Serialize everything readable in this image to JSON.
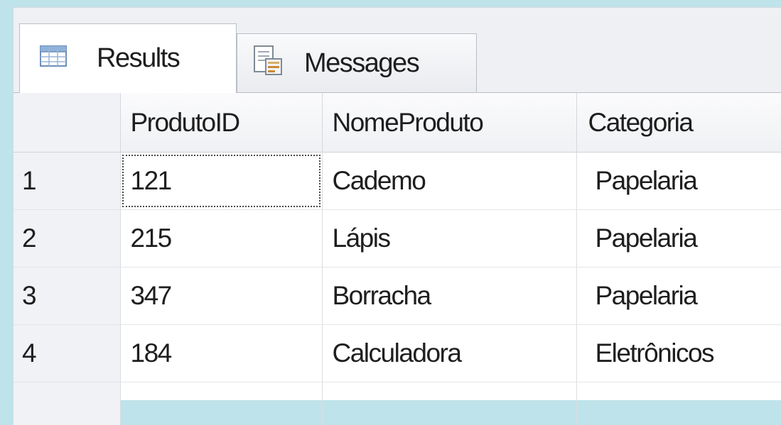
{
  "tabs": {
    "results": {
      "label": "Results",
      "icon": "grid-table-icon"
    },
    "messages": {
      "label": "Messages",
      "icon": "messages-document-icon"
    }
  },
  "grid": {
    "columns": [
      "ProdutoID",
      "NomeProduto",
      "Categoria"
    ],
    "rows": [
      {
        "num": "1",
        "cells": [
          "121",
          "Cademo",
          "Papelaria"
        ]
      },
      {
        "num": "2",
        "cells": [
          "215",
          "Lápis",
          "Papelaria"
        ]
      },
      {
        "num": "3",
        "cells": [
          "347",
          "Borracha",
          "Papelaria"
        ]
      },
      {
        "num": "4",
        "cells": [
          "184",
          "Calculadora",
          "Eletrônicos"
        ]
      }
    ]
  },
  "colors": {
    "background": "#bfe3ea",
    "selection_border": "#4a4a4a"
  }
}
